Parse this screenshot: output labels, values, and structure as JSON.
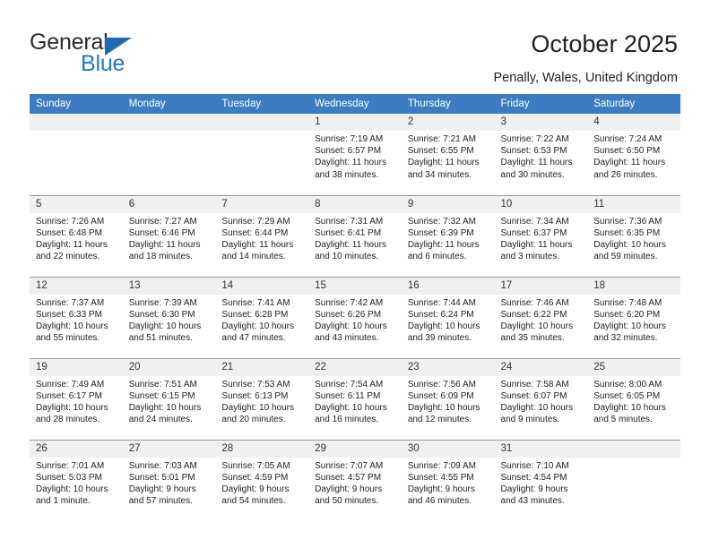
{
  "brand": {
    "name_top": "General",
    "name_bottom": "Blue",
    "triangle_icon": "triangle-icon",
    "accent_color": "#1f7ac4"
  },
  "header": {
    "title": "October 2025",
    "subtitle": "Penally, Wales, United Kingdom"
  },
  "calendar": {
    "header_bg": "#3b7dc0",
    "daynum_bg": "#f0f0f0",
    "weekday_headers": [
      "Sunday",
      "Monday",
      "Tuesday",
      "Wednesday",
      "Thursday",
      "Friday",
      "Saturday"
    ],
    "weeks": [
      [
        {
          "day": "",
          "lines": []
        },
        {
          "day": "",
          "lines": []
        },
        {
          "day": "",
          "lines": []
        },
        {
          "day": "1",
          "lines": [
            "Sunrise: 7:19 AM",
            "Sunset: 6:57 PM",
            "Daylight: 11 hours",
            "and 38 minutes."
          ]
        },
        {
          "day": "2",
          "lines": [
            "Sunrise: 7:21 AM",
            "Sunset: 6:55 PM",
            "Daylight: 11 hours",
            "and 34 minutes."
          ]
        },
        {
          "day": "3",
          "lines": [
            "Sunrise: 7:22 AM",
            "Sunset: 6:53 PM",
            "Daylight: 11 hours",
            "and 30 minutes."
          ]
        },
        {
          "day": "4",
          "lines": [
            "Sunrise: 7:24 AM",
            "Sunset: 6:50 PM",
            "Daylight: 11 hours",
            "and 26 minutes."
          ]
        }
      ],
      [
        {
          "day": "5",
          "lines": [
            "Sunrise: 7:26 AM",
            "Sunset: 6:48 PM",
            "Daylight: 11 hours",
            "and 22 minutes."
          ]
        },
        {
          "day": "6",
          "lines": [
            "Sunrise: 7:27 AM",
            "Sunset: 6:46 PM",
            "Daylight: 11 hours",
            "and 18 minutes."
          ]
        },
        {
          "day": "7",
          "lines": [
            "Sunrise: 7:29 AM",
            "Sunset: 6:44 PM",
            "Daylight: 11 hours",
            "and 14 minutes."
          ]
        },
        {
          "day": "8",
          "lines": [
            "Sunrise: 7:31 AM",
            "Sunset: 6:41 PM",
            "Daylight: 11 hours",
            "and 10 minutes."
          ]
        },
        {
          "day": "9",
          "lines": [
            "Sunrise: 7:32 AM",
            "Sunset: 6:39 PM",
            "Daylight: 11 hours",
            "and 6 minutes."
          ]
        },
        {
          "day": "10",
          "lines": [
            "Sunrise: 7:34 AM",
            "Sunset: 6:37 PM",
            "Daylight: 11 hours",
            "and 3 minutes."
          ]
        },
        {
          "day": "11",
          "lines": [
            "Sunrise: 7:36 AM",
            "Sunset: 6:35 PM",
            "Daylight: 10 hours",
            "and 59 minutes."
          ]
        }
      ],
      [
        {
          "day": "12",
          "lines": [
            "Sunrise: 7:37 AM",
            "Sunset: 6:33 PM",
            "Daylight: 10 hours",
            "and 55 minutes."
          ]
        },
        {
          "day": "13",
          "lines": [
            "Sunrise: 7:39 AM",
            "Sunset: 6:30 PM",
            "Daylight: 10 hours",
            "and 51 minutes."
          ]
        },
        {
          "day": "14",
          "lines": [
            "Sunrise: 7:41 AM",
            "Sunset: 6:28 PM",
            "Daylight: 10 hours",
            "and 47 minutes."
          ]
        },
        {
          "day": "15",
          "lines": [
            "Sunrise: 7:42 AM",
            "Sunset: 6:26 PM",
            "Daylight: 10 hours",
            "and 43 minutes."
          ]
        },
        {
          "day": "16",
          "lines": [
            "Sunrise: 7:44 AM",
            "Sunset: 6:24 PM",
            "Daylight: 10 hours",
            "and 39 minutes."
          ]
        },
        {
          "day": "17",
          "lines": [
            "Sunrise: 7:46 AM",
            "Sunset: 6:22 PM",
            "Daylight: 10 hours",
            "and 35 minutes."
          ]
        },
        {
          "day": "18",
          "lines": [
            "Sunrise: 7:48 AM",
            "Sunset: 6:20 PM",
            "Daylight: 10 hours",
            "and 32 minutes."
          ]
        }
      ],
      [
        {
          "day": "19",
          "lines": [
            "Sunrise: 7:49 AM",
            "Sunset: 6:17 PM",
            "Daylight: 10 hours",
            "and 28 minutes."
          ]
        },
        {
          "day": "20",
          "lines": [
            "Sunrise: 7:51 AM",
            "Sunset: 6:15 PM",
            "Daylight: 10 hours",
            "and 24 minutes."
          ]
        },
        {
          "day": "21",
          "lines": [
            "Sunrise: 7:53 AM",
            "Sunset: 6:13 PM",
            "Daylight: 10 hours",
            "and 20 minutes."
          ]
        },
        {
          "day": "22",
          "lines": [
            "Sunrise: 7:54 AM",
            "Sunset: 6:11 PM",
            "Daylight: 10 hours",
            "and 16 minutes."
          ]
        },
        {
          "day": "23",
          "lines": [
            "Sunrise: 7:56 AM",
            "Sunset: 6:09 PM",
            "Daylight: 10 hours",
            "and 12 minutes."
          ]
        },
        {
          "day": "24",
          "lines": [
            "Sunrise: 7:58 AM",
            "Sunset: 6:07 PM",
            "Daylight: 10 hours",
            "and 9 minutes."
          ]
        },
        {
          "day": "25",
          "lines": [
            "Sunrise: 8:00 AM",
            "Sunset: 6:05 PM",
            "Daylight: 10 hours",
            "and 5 minutes."
          ]
        }
      ],
      [
        {
          "day": "26",
          "lines": [
            "Sunrise: 7:01 AM",
            "Sunset: 5:03 PM",
            "Daylight: 10 hours",
            "and 1 minute."
          ]
        },
        {
          "day": "27",
          "lines": [
            "Sunrise: 7:03 AM",
            "Sunset: 5:01 PM",
            "Daylight: 9 hours",
            "and 57 minutes."
          ]
        },
        {
          "day": "28",
          "lines": [
            "Sunrise: 7:05 AM",
            "Sunset: 4:59 PM",
            "Daylight: 9 hours",
            "and 54 minutes."
          ]
        },
        {
          "day": "29",
          "lines": [
            "Sunrise: 7:07 AM",
            "Sunset: 4:57 PM",
            "Daylight: 9 hours",
            "and 50 minutes."
          ]
        },
        {
          "day": "30",
          "lines": [
            "Sunrise: 7:09 AM",
            "Sunset: 4:55 PM",
            "Daylight: 9 hours",
            "and 46 minutes."
          ]
        },
        {
          "day": "31",
          "lines": [
            "Sunrise: 7:10 AM",
            "Sunset: 4:54 PM",
            "Daylight: 9 hours",
            "and 43 minutes."
          ]
        },
        {
          "day": "",
          "lines": []
        }
      ]
    ]
  }
}
